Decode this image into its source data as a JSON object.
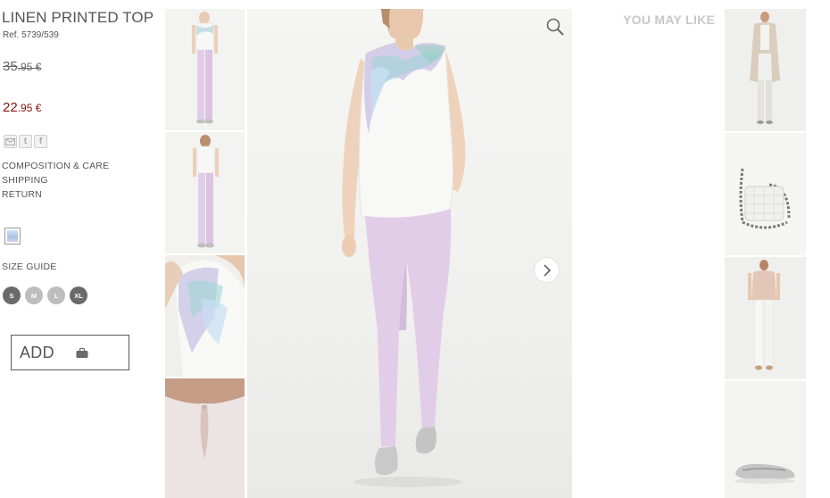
{
  "product": {
    "title": "LINEN PRINTED TOP",
    "ref": "Ref. 5739/539",
    "old_price_main": "35",
    "old_price_cents": ".95 €",
    "new_price_main": "22",
    "new_price_cents": ".95 €"
  },
  "share": [
    "email-icon",
    "twitter-icon",
    "facebook-icon"
  ],
  "links": [
    "COMPOSITION & CARE",
    "SHIPPING",
    "RETURN"
  ],
  "colors": {
    "selected_swatch": "#b9cfe9",
    "price_red": "#8a1313",
    "top_print_colors": [
      "#9fd3d8",
      "#b5a9df",
      "#c7def3"
    ],
    "pants": "#e2cde8"
  },
  "size_guide_label": "SIZE GUIDE",
  "sizes": [
    {
      "label": "S",
      "available": true
    },
    {
      "label": "M",
      "available": false
    },
    {
      "label": "L",
      "available": false
    },
    {
      "label": "XL",
      "available": true
    }
  ],
  "add_button": {
    "label": "ADD",
    "icon": "shopping-bag-icon"
  },
  "gallery": {
    "zoom_icon": "magnifier-icon",
    "next_icon": "chevron-right-icon",
    "thumbnails": [
      "front-full-view",
      "back-full-view",
      "print-detail",
      "back-keyhole-detail"
    ]
  },
  "you_may_like": {
    "title": "YOU MAY LIKE",
    "items": [
      "beige-trench-coat-outfit",
      "white-quilted-bag",
      "blouse-and-white-jeans-outfit",
      "silver-ballet-flats"
    ]
  }
}
